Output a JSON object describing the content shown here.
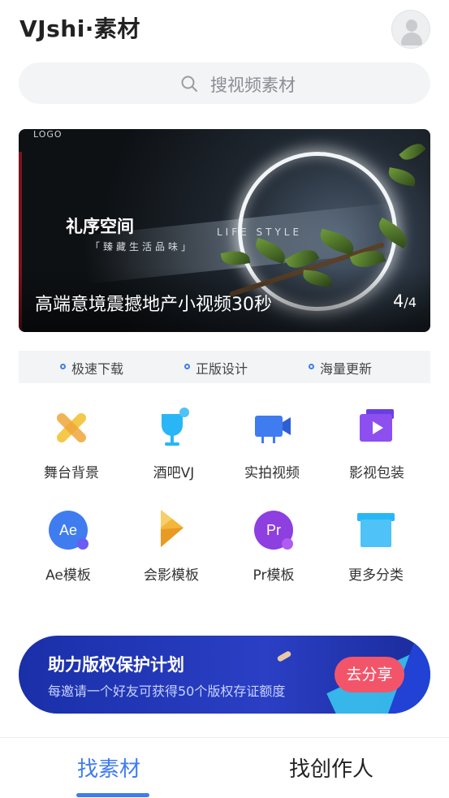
{
  "header": {
    "title": "VJshi·素材"
  },
  "search": {
    "placeholder": "搜视频素材"
  },
  "banner": {
    "logo_text": "LOGO",
    "headline": "礼序空间",
    "sub_cn": "「臻藏生活品味」",
    "sub_en": "LIFE STYLE",
    "caption": "高端意境震撼地产小视频30秒",
    "current": "4",
    "total": "/4"
  },
  "features": [
    "极速下载",
    "正版设计",
    "海量更新"
  ],
  "categories": [
    {
      "label": "舞台背景",
      "icon": "stage-icon"
    },
    {
      "label": "酒吧VJ",
      "icon": "cocktail-icon"
    },
    {
      "label": "实拍视频",
      "icon": "camera-icon"
    },
    {
      "label": "影视包装",
      "icon": "film-package-icon"
    },
    {
      "label": "Ae模板",
      "icon": "ae-icon",
      "icon_text": "Ae"
    },
    {
      "label": "会影模板",
      "icon": "corel-icon"
    },
    {
      "label": "Pr模板",
      "icon": "pr-icon",
      "icon_text": "Pr"
    },
    {
      "label": "更多分类",
      "icon": "box-icon"
    }
  ],
  "promo": {
    "title": "助力版权保护计划",
    "subtitle": "每邀请一个好友可获得50个版权存证额度",
    "button": "去分享"
  },
  "bottom_tabs": [
    {
      "label": "找素材",
      "active": true
    },
    {
      "label": "找创作人",
      "active": false
    }
  ],
  "colors": {
    "accent": "#3f7cf0",
    "promo_bg": "#2a3fc4",
    "cta": "#f2556a"
  }
}
